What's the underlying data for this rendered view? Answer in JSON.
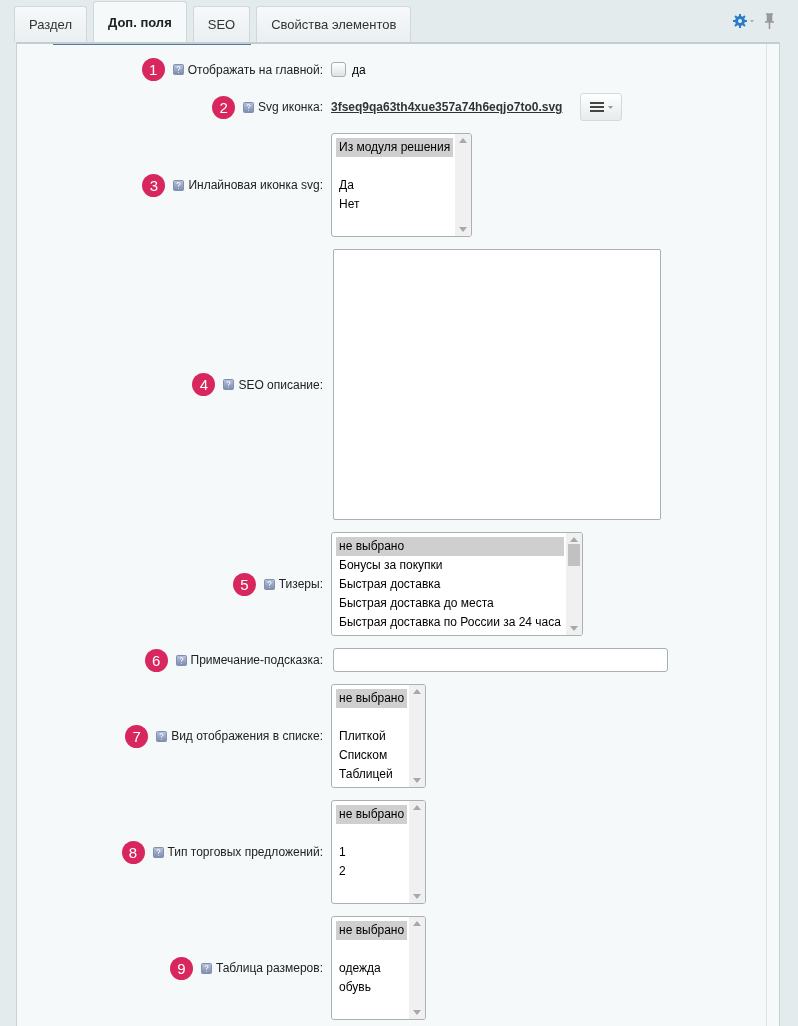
{
  "tabs": [
    {
      "label": "Раздел",
      "selected": false
    },
    {
      "label": "Доп. поля",
      "selected": true
    },
    {
      "label": "SEO",
      "selected": false
    },
    {
      "label": "Свойства элементов",
      "selected": false
    }
  ],
  "fields": [
    {
      "marker": "1",
      "label": "Отображать на главной:",
      "kind": "checkbox",
      "checked": false,
      "option": "да"
    },
    {
      "marker": "2",
      "label": "Svg иконка:",
      "kind": "file",
      "value": "3fseq9qa63th4xue357a74h6eqjo7to0.svg"
    },
    {
      "marker": "3",
      "label": "Инлайновая иконка svg:",
      "kind": "listbox",
      "scrollable": false,
      "options": [
        {
          "text": "Из модуля решения",
          "selected": true,
          "gap_after": true
        },
        {
          "text": "Да",
          "selected": false,
          "gap_after": false
        },
        {
          "text": "Нет",
          "selected": false,
          "gap_after": false
        }
      ]
    },
    {
      "marker": "4",
      "label": "SEO описание:",
      "kind": "textarea"
    },
    {
      "marker": "5",
      "label": "Тизеры:",
      "kind": "listbox",
      "scrollable": true,
      "options": [
        {
          "text": "не выбрано",
          "selected": true,
          "gap_after": false
        },
        {
          "text": "Бонусы за покупки",
          "selected": false,
          "gap_after": false
        },
        {
          "text": "Быстрая доставка",
          "selected": false,
          "gap_after": false
        },
        {
          "text": "Быстрая доставка до места",
          "selected": false,
          "gap_after": false
        },
        {
          "text": "Быстрая доставка по России за 24 часа",
          "selected": false,
          "gap_after": false
        }
      ]
    },
    {
      "marker": "6",
      "label": "Примечание-подсказка:",
      "kind": "text"
    },
    {
      "marker": "7",
      "label": "Вид отображения в списке:",
      "kind": "listbox",
      "scrollable": false,
      "options": [
        {
          "text": "не выбрано",
          "selected": true,
          "gap_after": true
        },
        {
          "text": "Плиткой",
          "selected": false,
          "gap_after": false
        },
        {
          "text": "Списком",
          "selected": false,
          "gap_after": false
        },
        {
          "text": "Таблицей",
          "selected": false,
          "gap_after": false
        }
      ]
    },
    {
      "marker": "8",
      "label": "Тип торговых предложений:",
      "kind": "listbox",
      "scrollable": false,
      "options": [
        {
          "text": "не выбрано",
          "selected": true,
          "gap_after": true
        },
        {
          "text": "1",
          "selected": false,
          "gap_after": false
        },
        {
          "text": "2",
          "selected": false,
          "gap_after": false
        }
      ]
    },
    {
      "marker": "9",
      "label": "Таблица размеров:",
      "kind": "listbox",
      "scrollable": false,
      "options": [
        {
          "text": "не выбрано",
          "selected": true,
          "gap_after": true
        },
        {
          "text": "одежда",
          "selected": false,
          "gap_after": false
        },
        {
          "text": "обувь",
          "selected": false,
          "gap_after": false
        }
      ]
    }
  ]
}
